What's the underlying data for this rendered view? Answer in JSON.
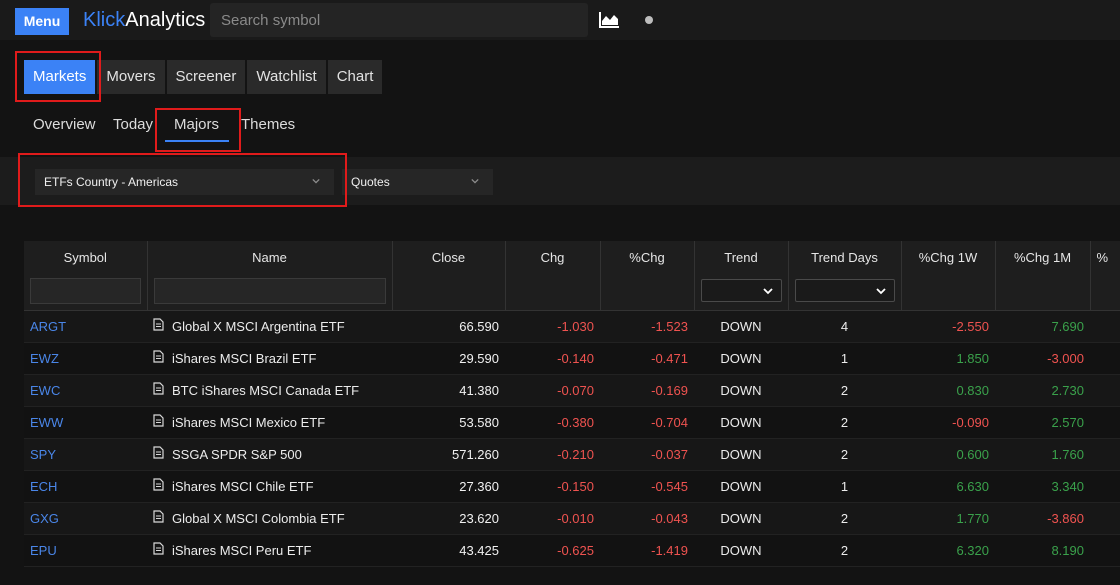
{
  "header": {
    "menu_label": "Menu",
    "brand_part1": "Klick",
    "brand_part2": "Analytics",
    "search_placeholder": "Search symbol",
    "chart_icon": "area-chart-icon",
    "status_icon": "dot-icon"
  },
  "colors": {
    "accent": "#3b82f6",
    "negative": "#ef5350",
    "positive": "#3aa14b",
    "highlight_box": "#e01b1b"
  },
  "main_tabs": [
    {
      "label": "Markets",
      "active": true
    },
    {
      "label": "Movers",
      "active": false
    },
    {
      "label": "Screener",
      "active": false
    },
    {
      "label": "Watchlist",
      "active": false
    },
    {
      "label": "Chart",
      "active": false
    }
  ],
  "sub_tabs": [
    {
      "label": "Overview",
      "active": false
    },
    {
      "label": "Today",
      "active": false
    },
    {
      "label": "Majors",
      "active": true
    },
    {
      "label": "Themes",
      "active": false
    }
  ],
  "filters": {
    "list_select": "ETFs Country - Americas",
    "view_select": "Quotes"
  },
  "table": {
    "columns": [
      "Symbol",
      "Name",
      "Close",
      "Chg",
      "%Chg",
      "Trend",
      "Trend Days",
      "%Chg 1W",
      "%Chg 1M",
      "%"
    ],
    "rows": [
      {
        "symbol": "ARGT",
        "name": "Global X MSCI Argentina ETF",
        "close": "66.590",
        "chg": "-1.030",
        "pchg": "-1.523",
        "trend": "DOWN",
        "trend_days": "4",
        "pchg_1w": "-2.550",
        "pchg_1m": "7.690"
      },
      {
        "symbol": "EWZ",
        "name": "iShares MSCI Brazil ETF",
        "close": "29.590",
        "chg": "-0.140",
        "pchg": "-0.471",
        "trend": "DOWN",
        "trend_days": "1",
        "pchg_1w": "1.850",
        "pchg_1m": "-3.000"
      },
      {
        "symbol": "EWC",
        "name": "BTC iShares MSCI Canada ETF",
        "close": "41.380",
        "chg": "-0.070",
        "pchg": "-0.169",
        "trend": "DOWN",
        "trend_days": "2",
        "pchg_1w": "0.830",
        "pchg_1m": "2.730"
      },
      {
        "symbol": "EWW",
        "name": "iShares MSCI Mexico ETF",
        "close": "53.580",
        "chg": "-0.380",
        "pchg": "-0.704",
        "trend": "DOWN",
        "trend_days": "2",
        "pchg_1w": "-0.090",
        "pchg_1m": "2.570"
      },
      {
        "symbol": "SPY",
        "name": "SSGA SPDR S&P 500",
        "close": "571.260",
        "chg": "-0.210",
        "pchg": "-0.037",
        "trend": "DOWN",
        "trend_days": "2",
        "pchg_1w": "0.600",
        "pchg_1m": "1.760"
      },
      {
        "symbol": "ECH",
        "name": "iShares MSCI Chile ETF",
        "close": "27.360",
        "chg": "-0.150",
        "pchg": "-0.545",
        "trend": "DOWN",
        "trend_days": "1",
        "pchg_1w": "6.630",
        "pchg_1m": "3.340"
      },
      {
        "symbol": "GXG",
        "name": "Global X MSCI Colombia ETF",
        "close": "23.620",
        "chg": "-0.010",
        "pchg": "-0.043",
        "trend": "DOWN",
        "trend_days": "2",
        "pchg_1w": "1.770",
        "pchg_1m": "-3.860"
      },
      {
        "symbol": "EPU",
        "name": "iShares MSCI Peru ETF",
        "close": "43.425",
        "chg": "-0.625",
        "pchg": "-1.419",
        "trend": "DOWN",
        "trend_days": "2",
        "pchg_1w": "6.320",
        "pchg_1m": "8.190"
      }
    ]
  }
}
